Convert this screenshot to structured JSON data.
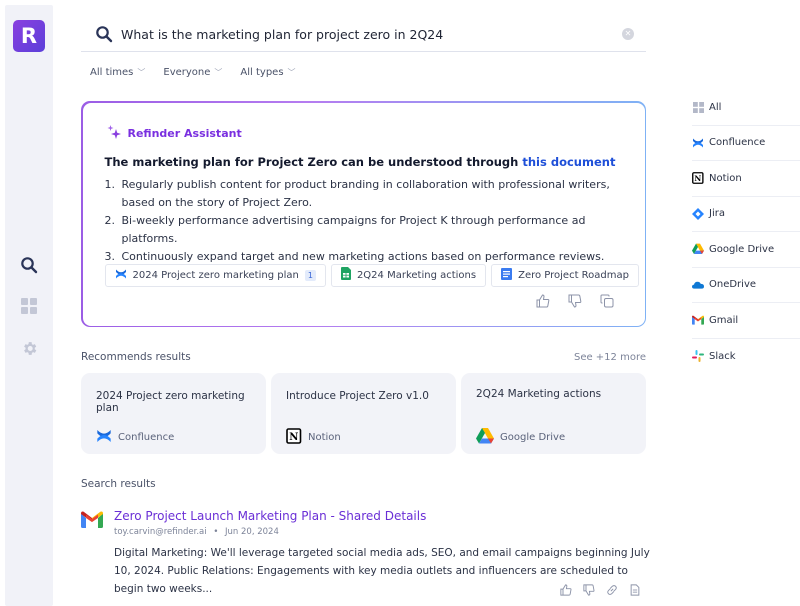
{
  "app": {
    "logo_letter": "R"
  },
  "rail": {
    "items": [
      {
        "name": "search",
        "icon": "search-icon",
        "active": true
      },
      {
        "name": "dashboard",
        "icon": "grid-icon",
        "active": false
      },
      {
        "name": "settings",
        "icon": "gear-icon",
        "active": false
      }
    ]
  },
  "search": {
    "query": "What is the marketing plan for project zero in 2Q24",
    "icon": "search-icon",
    "clear_icon": "clear-icon"
  },
  "filters": [
    {
      "label": "All times"
    },
    {
      "label": "Everyone"
    },
    {
      "label": "All types"
    }
  ],
  "assistant": {
    "name": "Refinder Assistant",
    "icon": "sparkles-icon",
    "title_prefix": "The marketing plan for Project Zero can be understood through",
    "title_link": "this document",
    "points": [
      {
        "num": "1.",
        "text": "Regularly publish content for product branding in collaboration with professional writers, based on the story of Project Zero."
      },
      {
        "num": "2.",
        "text": "Bi-weekly performance advertising campaigns for Project K through performance ad platforms."
      },
      {
        "num": "3.",
        "text": "Continuously expand target and new marketing actions based on performance reviews."
      }
    ],
    "sources": [
      {
        "label": "2024 Project zero marketing plan",
        "icon": "confluence-icon",
        "badge": "1"
      },
      {
        "label": "2Q24 Marketing actions",
        "icon": "google-sheets-icon"
      },
      {
        "label": "Zero Project Roadmap",
        "icon": "google-docs-icon"
      }
    ],
    "actions": [
      "thumbs-up-icon",
      "thumbs-down-icon",
      "copy-icon"
    ]
  },
  "recommends": {
    "label": "Recommends results",
    "more": "See +12 more",
    "cards": [
      {
        "title": "2024 Project zero marketing plan",
        "source": "Confluence",
        "icon": "confluence-icon"
      },
      {
        "title": "Introduce Project Zero v1.0",
        "source": "Notion",
        "icon": "notion-icon"
      },
      {
        "title": "2Q24 Marketing actions",
        "source": "Google Drive",
        "icon": "google-drive-icon"
      }
    ]
  },
  "results": {
    "label": "Search results",
    "items": [
      {
        "title": "Zero Project Launch Marketing Plan - Shared Details",
        "author": "toy.carvin@refinder.ai",
        "separator": "•",
        "date": "Jun 20, 2024",
        "icon": "gmail-icon",
        "body": "Digital Marketing: We'll leverage targeted social media ads, SEO, and email campaigns beginning July 10, 2024. Public Relations: Engagements with key media outlets and influencers are scheduled to begin two weeks...",
        "actions": [
          "thumbs-up-icon",
          "thumbs-down-icon",
          "link-icon",
          "document-icon"
        ]
      }
    ]
  },
  "source_filter": {
    "items": [
      {
        "label": "All",
        "icon": "grid-icon"
      },
      {
        "label": "Confluence",
        "icon": "confluence-icon"
      },
      {
        "label": "Notion",
        "icon": "notion-icon"
      },
      {
        "label": "Jira",
        "icon": "jira-icon"
      },
      {
        "label": "Google Drive",
        "icon": "google-drive-icon"
      },
      {
        "label": "OneDrive",
        "icon": "onedrive-icon"
      },
      {
        "label": "Gmail",
        "icon": "gmail-icon"
      },
      {
        "label": "Slack",
        "icon": "slack-icon"
      }
    ]
  },
  "colors": {
    "brand": "#6b3fe0",
    "assistant_accent": "#7a2fe0",
    "link": "#1e4fd8",
    "result_title": "#6a2fd6",
    "rail_bg": "#f1f2f8",
    "card_bg": "#f2f3f8"
  }
}
